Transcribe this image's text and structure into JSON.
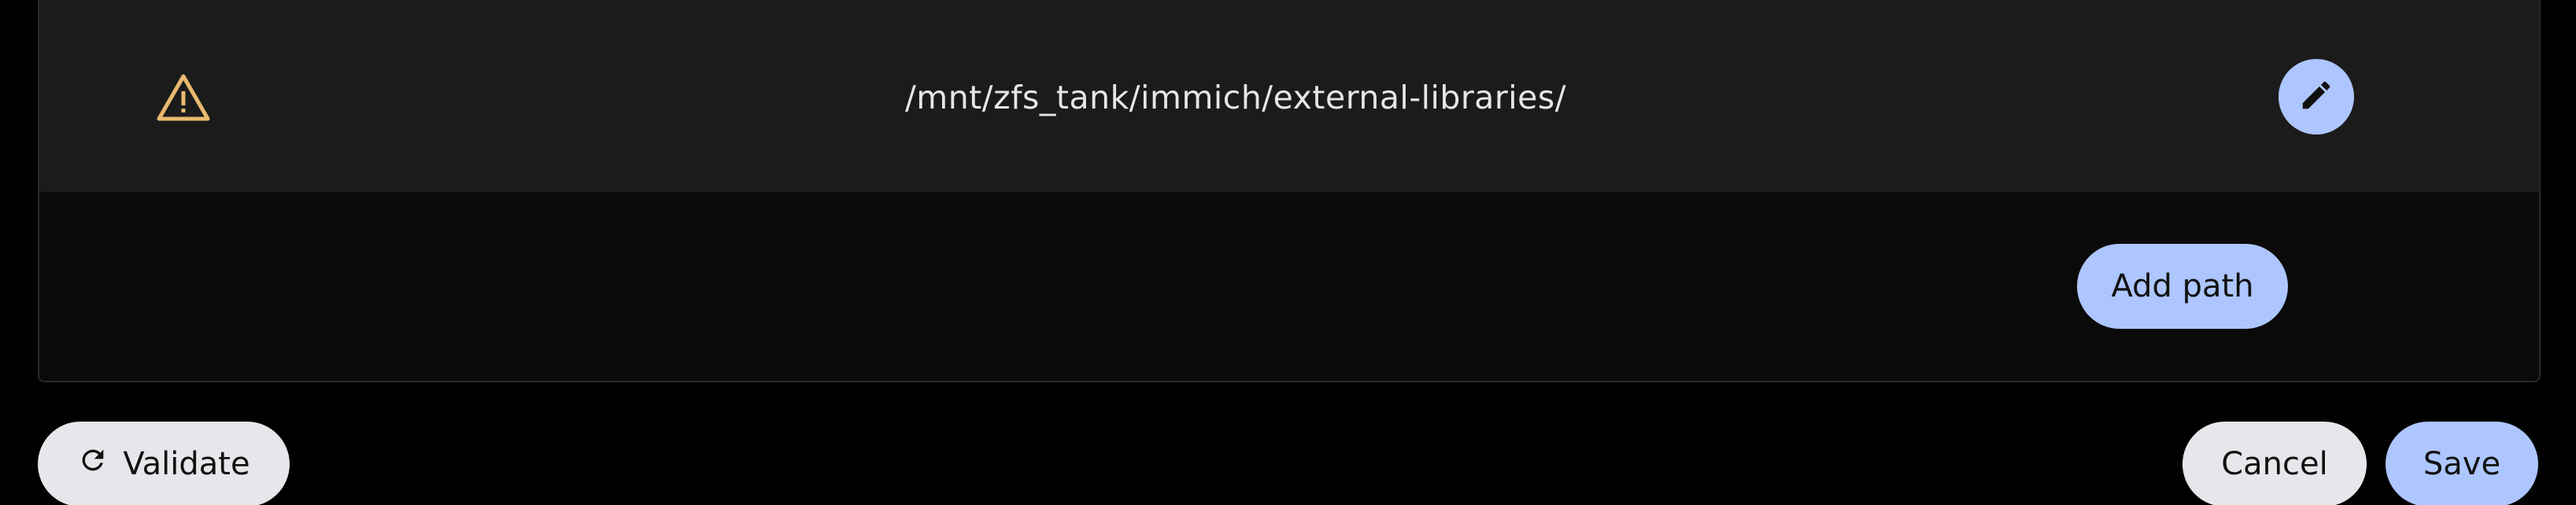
{
  "import_paths": {
    "items": [
      {
        "path": "/mnt/zfs_tank/immich/external-libraries/",
        "status_icon": "warning-icon",
        "edit_icon": "pencil-icon"
      }
    ],
    "add_path_label": "Add path"
  },
  "footer": {
    "validate_label": "Validate",
    "validate_icon": "refresh-icon",
    "cancel_label": "Cancel",
    "save_label": "Save"
  },
  "colors": {
    "accent": "#adc6ff",
    "warning": "#e9b96e",
    "neutral_button": "#e6e7ea",
    "row_background": "#1b1b1b",
    "panel_background": "#0a0a0a"
  }
}
